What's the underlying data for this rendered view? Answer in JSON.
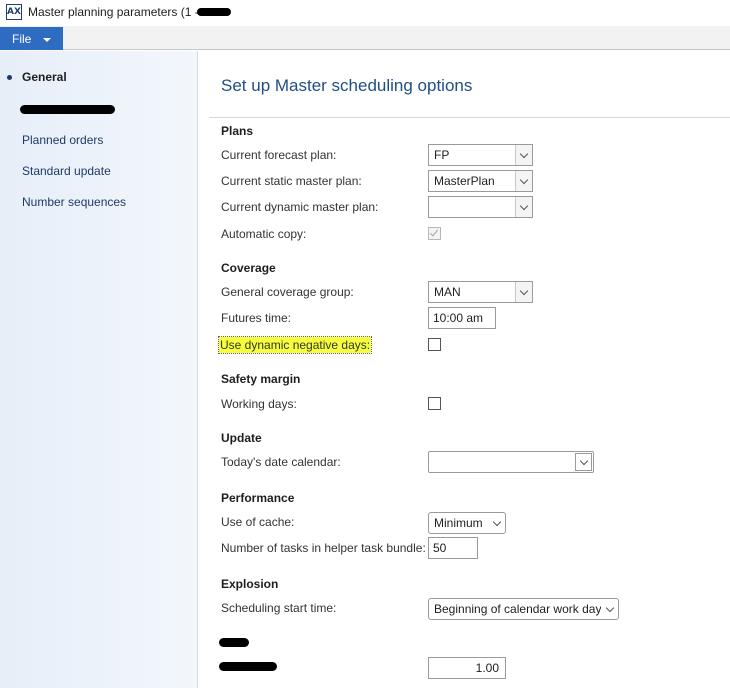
{
  "window": {
    "title": "Master planning parameters (1 - ",
    "icon": "app-logo-icon"
  },
  "menubar": {
    "file_label": "File"
  },
  "nav": {
    "items": [
      {
        "label": "General",
        "active": true
      },
      {
        "label": "Planned orders"
      },
      {
        "label": "Standard update"
      },
      {
        "label": "Number sequences"
      }
    ]
  },
  "main": {
    "title": "Set up Master scheduling options",
    "sections": {
      "plans": "Plans",
      "coverage": "Coverage",
      "safety_margin": "Safety margin",
      "update": "Update",
      "performance": "Performance",
      "explosion": "Explosion"
    },
    "fields": {
      "current_forecast_plan": {
        "label": "Current forecast plan:",
        "value": "FP"
      },
      "current_static_master_plan": {
        "label": "Current static master plan:",
        "value": "MasterPlan"
      },
      "current_dynamic_master_plan": {
        "label": "Current dynamic master plan:",
        "value": ""
      },
      "automatic_copy": {
        "label": "Automatic copy:",
        "checked": true,
        "enabled": false
      },
      "general_coverage_group": {
        "label": "General coverage group:",
        "value": "MAN"
      },
      "futures_time": {
        "label": "Futures time:",
        "value": "10:00 am"
      },
      "use_dynamic_negative_days": {
        "label": "Use dynamic negative days:",
        "checked": false
      },
      "working_days": {
        "label": "Working days:",
        "checked": false
      },
      "todays_date_calendar": {
        "label": "Today's date calendar:",
        "value": ""
      },
      "use_of_cache": {
        "label": "Use of cache:",
        "value": "Minimum"
      },
      "tasks_in_helper_bundle": {
        "label": "Number of tasks in helper task bundle:",
        "value": "50"
      },
      "scheduling_start_time": {
        "label": "Scheduling start time:",
        "value": "Beginning of calendar work day"
      },
      "redacted_field": {
        "value": "1.00"
      }
    }
  },
  "colors": {
    "accent": "#2e6cc1",
    "title": "#1f4e85",
    "highlight": "#f6ff3a",
    "nav_bg": "#e6eef8"
  }
}
